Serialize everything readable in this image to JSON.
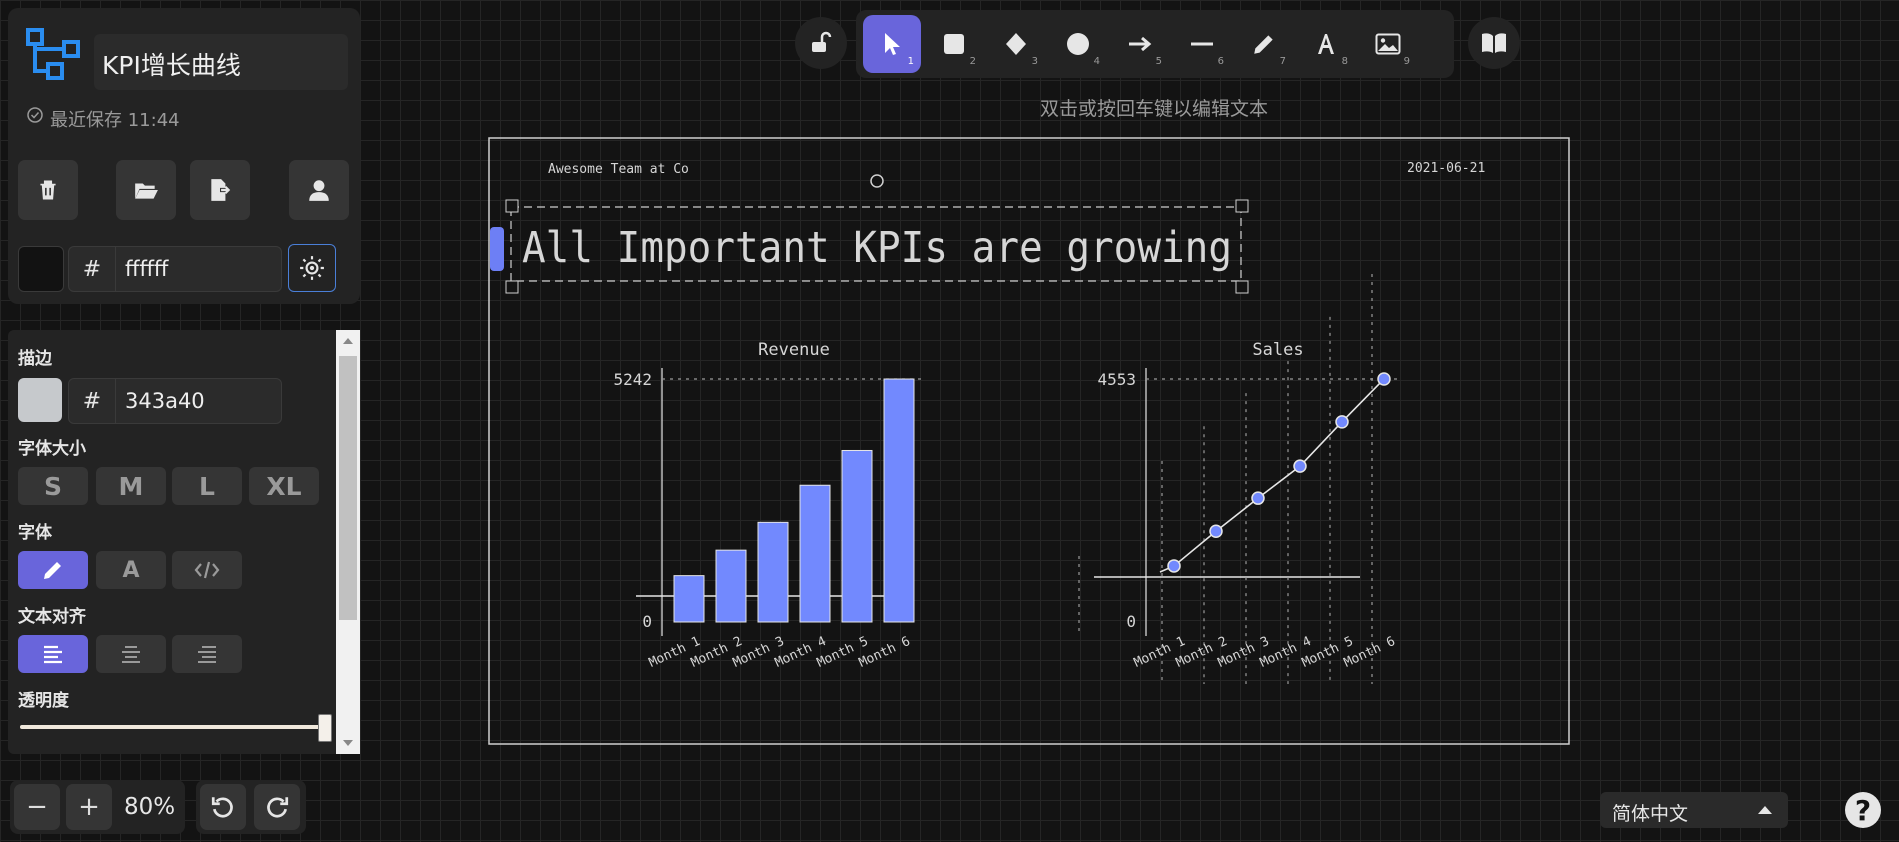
{
  "file": {
    "title": "KPI增长曲线",
    "saved": "最近保存 11:44"
  },
  "canvas_bg": {
    "hex": "ffffff"
  },
  "toolbar": {
    "hint": "双击或按回车键以编辑文本",
    "tools": [
      {
        "name": "select",
        "num": "1"
      },
      {
        "name": "rectangle",
        "num": "2"
      },
      {
        "name": "diamond",
        "num": "3"
      },
      {
        "name": "ellipse",
        "num": "4"
      },
      {
        "name": "arrow",
        "num": "5"
      },
      {
        "name": "line",
        "num": "6"
      },
      {
        "name": "pencil",
        "num": "7"
      },
      {
        "name": "text",
        "num": "8"
      },
      {
        "name": "image",
        "num": "9"
      }
    ]
  },
  "props": {
    "stroke_label": "描边",
    "stroke_hex": "343a40",
    "font_size_label": "字体大小",
    "sizes": [
      "S",
      "M",
      "L",
      "XL"
    ],
    "font_label": "字体",
    "font_text_btn": "A",
    "align_label": "文本对齐",
    "opacity_label": "透明度",
    "opacity": 1.0
  },
  "zoom": {
    "minus": "−",
    "plus": "+",
    "level": "80%"
  },
  "language": {
    "selected": "简体中文"
  },
  "help": "?",
  "drawing": {
    "header_left": "Awesome Team at Co",
    "header_date": "2021-06-21",
    "headline": "All Important KPIs are growing"
  },
  "chart_data": [
    {
      "type": "bar",
      "title": "Revenue",
      "categories": [
        "Month 1",
        "Month 2",
        "Month 3",
        "Month 4",
        "Month 5",
        "Month 6"
      ],
      "values": [
        1000,
        1550,
        2150,
        2950,
        3700,
        5242
      ],
      "ylim": [
        0,
        5242
      ],
      "ytick_labels": [
        "0",
        "5242"
      ],
      "color": "#7289fe"
    },
    {
      "type": "line",
      "title": "Sales",
      "categories": [
        "Month 1",
        "Month 2",
        "Month 3",
        "Month 4",
        "Month 5",
        "Month 6"
      ],
      "values": [
        1050,
        1700,
        2320,
        2920,
        3750,
        4553
      ],
      "ylim": [
        0,
        4553
      ],
      "ytick_labels": [
        "0",
        "4553"
      ],
      "color": "#7289fe"
    }
  ]
}
